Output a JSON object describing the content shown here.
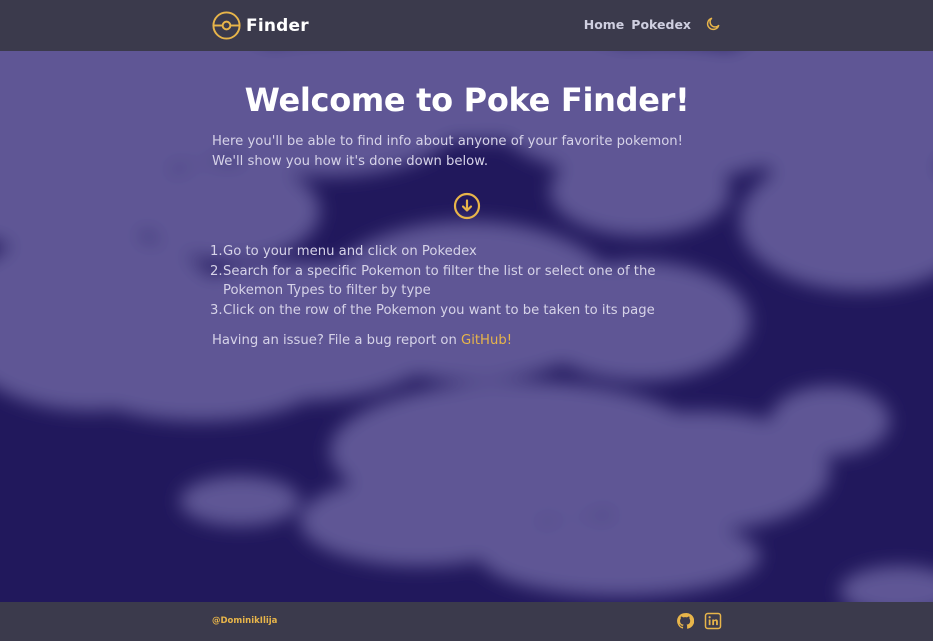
{
  "header": {
    "brand": "Finder",
    "nav": [
      {
        "label": "Home"
      },
      {
        "label": "Pokedex"
      }
    ],
    "theme_icon": "moon-icon",
    "logo_icon": "pokeball-icon"
  },
  "main": {
    "title": "Welcome to Poke Finder!",
    "intro_lines": [
      "Here you'll be able to find info about anyone of your favorite pokemon!",
      "We'll show you how it's done down below."
    ],
    "scroll_icon": "arrow-down-circle-icon",
    "steps": [
      {
        "num": "1.",
        "lines": [
          "Go to your menu and click on Pokedex"
        ]
      },
      {
        "num": "2.",
        "lines": [
          "Search for a specific Pokemon to filter the list or select one of the",
          "Pokemon Types to filter by type"
        ]
      },
      {
        "num": "3.",
        "lines": [
          "Click on the row of the Pokemon you want to be taken to its page"
        ]
      }
    ],
    "issue_text": "Having an issue? File a bug report on ",
    "issue_link": "GitHub!"
  },
  "footer": {
    "handle": "@DominikIlija",
    "icons": [
      "github-icon",
      "linkedin-icon"
    ]
  },
  "colors": {
    "accent": "#e8b54a",
    "bar": "#3b3a4c",
    "background": "#21185c",
    "cloud": "#5f5795"
  }
}
